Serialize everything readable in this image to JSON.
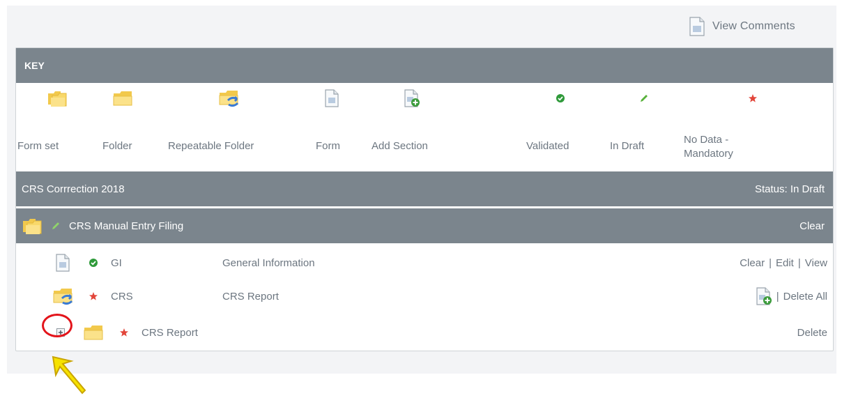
{
  "header": {
    "view_comments": "View Comments"
  },
  "key": {
    "title": "KEY",
    "items": [
      {
        "label": "Form set",
        "icon": "form-set-icon"
      },
      {
        "label": "Folder",
        "icon": "folder-icon"
      },
      {
        "label": "Repeatable Folder",
        "icon": "repeatable-folder-icon"
      },
      {
        "label": "Form",
        "icon": "form-icon"
      },
      {
        "label": "Add Section",
        "icon": "add-section-icon"
      },
      {
        "label": "Validated",
        "icon": "check-icon"
      },
      {
        "label": "In Draft",
        "icon": "pencil-icon"
      },
      {
        "label": "No Data - Mandatory",
        "icon": "star-icon"
      }
    ]
  },
  "filing": {
    "title": "CRS Corrrection 2018",
    "status": "Status: In Draft"
  },
  "form_set": {
    "name": "CRS Manual Entry Filing",
    "action": "Clear"
  },
  "rows": [
    {
      "code": "GI",
      "description": "General Information",
      "actions": [
        "Clear",
        "Edit",
        "View"
      ],
      "status": "validated"
    },
    {
      "code": "CRS",
      "description": "CRS Report",
      "actions": [
        "Delete All"
      ],
      "status": "no-data-mandatory"
    },
    {
      "code": "CRS Report",
      "description": "",
      "actions": [
        "Delete"
      ],
      "status": "no-data-mandatory"
    }
  ],
  "colors": {
    "bar": "#7b858d",
    "validated": "#2f9a3a",
    "draft": "#57b13a",
    "mandatory": "#e2453a",
    "annotation_circle": "#e3141b",
    "annotation_arrow": "#f6e200"
  }
}
